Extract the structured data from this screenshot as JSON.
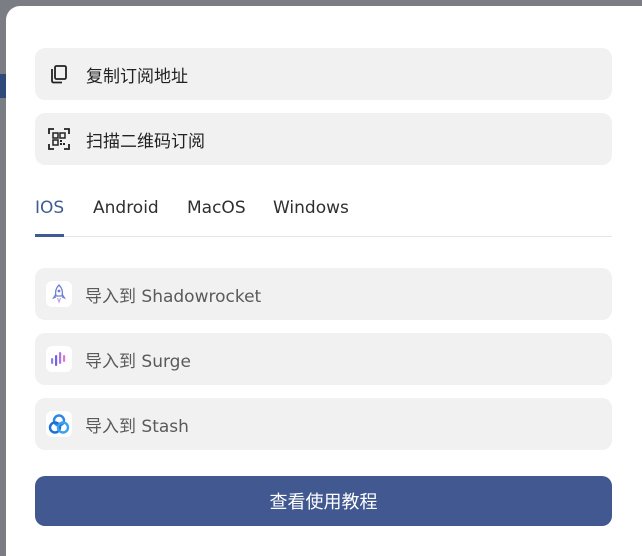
{
  "modal": {
    "copy_button_label": "复制订阅地址",
    "qr_button_label": "扫描二维码订阅",
    "tabs": [
      {
        "label": "IOS",
        "active": true
      },
      {
        "label": "Android",
        "active": false
      },
      {
        "label": "MacOS",
        "active": false
      },
      {
        "label": "Windows",
        "active": false
      }
    ],
    "import_buttons": [
      {
        "label": "导入到 Shadowrocket",
        "icon": "shadowrocket-icon"
      },
      {
        "label": "导入到 Surge",
        "icon": "surge-icon"
      },
      {
        "label": "导入到 Stash",
        "icon": "stash-icon"
      }
    ],
    "tutorial_button_label": "查看使用教程"
  },
  "colors": {
    "accent": "#3f5b94",
    "primary_button": "#415990",
    "button_bg": "#f1f1f1",
    "overlay": "#7a7d83"
  }
}
